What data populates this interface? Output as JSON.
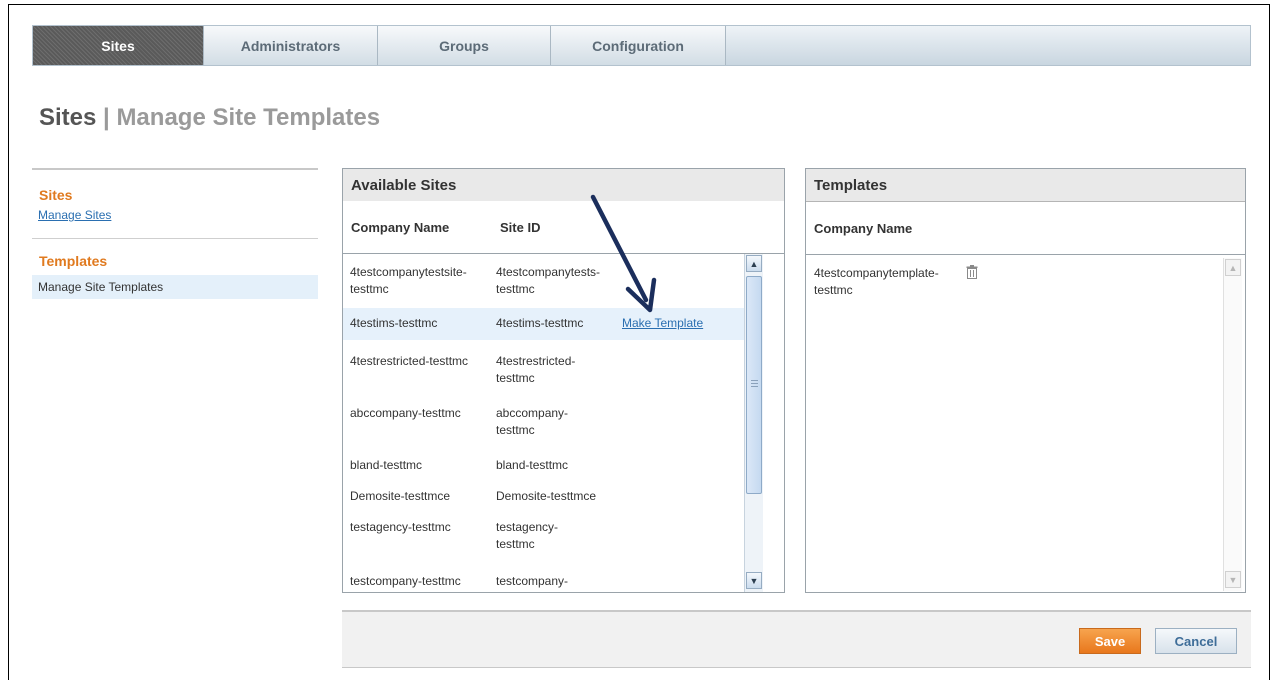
{
  "tabs": [
    {
      "label": "Sites",
      "active": true
    },
    {
      "label": "Administrators"
    },
    {
      "label": "Groups"
    },
    {
      "label": "Configuration"
    }
  ],
  "page_title": {
    "main": "Sites",
    "separator": " | ",
    "sub": "Manage Site Templates"
  },
  "leftnav": {
    "sites_heading": "Sites",
    "manage_sites": "Manage Sites",
    "templates_heading": "Templates",
    "manage_site_templates": "Manage Site Templates"
  },
  "available_sites": {
    "title": "Available Sites",
    "col_company": "Company Name",
    "col_siteid": "Site ID",
    "rows": [
      {
        "company": "4testcompanytestsite-testtmc",
        "site_id": "4testcompanytests-testtmc"
      },
      {
        "company": "4testims-testtmc",
        "site_id": "4testims-testtmc",
        "action": "Make Template"
      },
      {
        "company": "4testrestricted-testtmc",
        "site_id": "4testrestricted-testtmc"
      },
      {
        "company": "abccompany-testtmc",
        "site_id": "abccompany-testtmc"
      },
      {
        "company": "bland-testtmc",
        "site_id": "bland-testtmc"
      },
      {
        "company": "Demosite-testtmce",
        "site_id": "Demosite-testtmce"
      },
      {
        "company": "testagency-testtmc",
        "site_id": "testagency-testtmc"
      },
      {
        "company": "testcompany-testtmc",
        "site_id": "testcompany-"
      }
    ]
  },
  "templates": {
    "title": "Templates",
    "col_company": "Company Name",
    "rows": [
      {
        "company": "4testcompanytemplate-testtmc",
        "icon": "trash-icon"
      }
    ]
  },
  "buttons": {
    "save": "Save",
    "cancel": "Cancel"
  },
  "colors": {
    "accent": "#e07a1f",
    "link": "#2a6fb1",
    "arrow": "#1b2e5c"
  }
}
